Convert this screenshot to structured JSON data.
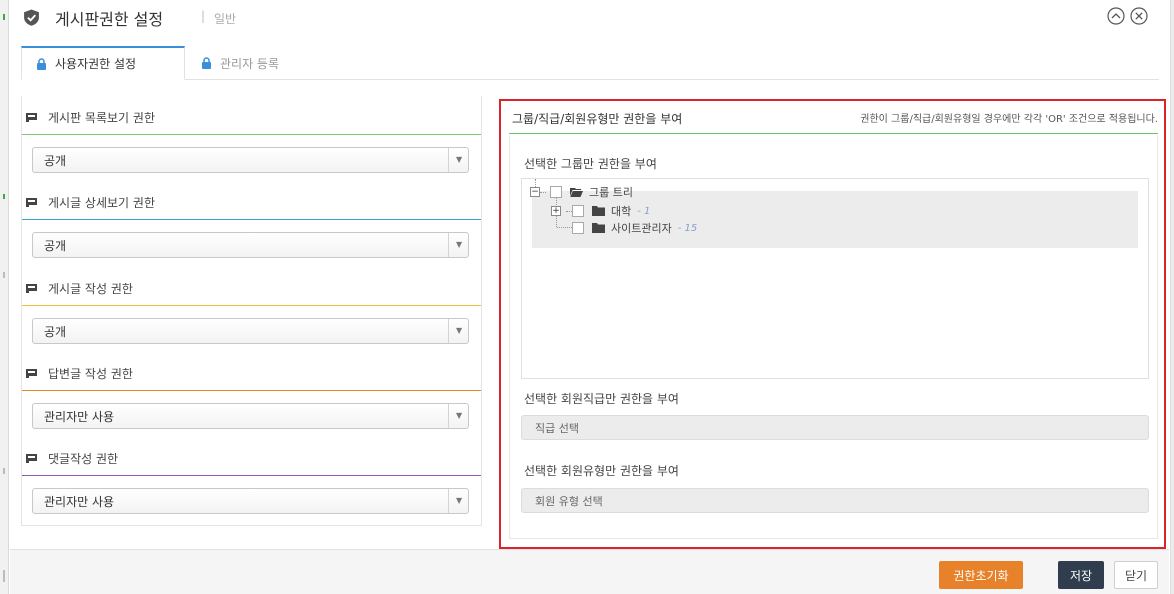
{
  "header": {
    "title": "게시판권한 설정",
    "separator": "|",
    "subtitle": "일반"
  },
  "tabs": [
    {
      "label": "사용자권한 설정",
      "active": true
    },
    {
      "label": "관리자 등록",
      "active": false
    }
  ],
  "permissions": [
    {
      "label": "게시판 목록보기 권한",
      "value": "공개",
      "color": "#7cc86c"
    },
    {
      "label": "게시글 상세보기 권한",
      "value": "공개",
      "color": "#3aa6c8"
    },
    {
      "label": "게시글 작성 권한",
      "value": "공개",
      "color": "#f0c23c"
    },
    {
      "label": "답변글 작성 권한",
      "value": "관리자만 사용",
      "color": "#e8862a"
    },
    {
      "label": "댓글작성 권한",
      "value": "관리자만 사용",
      "color": "#8a5bb8"
    }
  ],
  "right_panel": {
    "title": "그룹/직급/회원유형만 권한을 부여",
    "note": "권한이 그룹/직급/회원유형일 경우에만 각각 'OR' 조건으로 적용됩니다.",
    "group_section": {
      "label": "선택한 그룹만 권한을 부여",
      "tree": {
        "root": {
          "label": "그룹 트리"
        },
        "children": [
          {
            "label": "대학",
            "count": "- 1"
          },
          {
            "label": "사이트관리자",
            "count": "- 15"
          }
        ]
      }
    },
    "rank_section": {
      "label": "선택한 회원직급만 권한을 부여",
      "placeholder": "직급 선택"
    },
    "type_section": {
      "label": "선택한 회원유형만 권한을 부여",
      "placeholder": "회원 유형 선택"
    }
  },
  "footer": {
    "reset_label": "권한초기화",
    "save_label": "저장",
    "close_label": "닫기"
  },
  "colors": {
    "accent_blue": "#3b8fd9",
    "highlight_red": "#d9252a",
    "reset_orange": "#e8822a",
    "save_dark": "#2f3d4e"
  }
}
